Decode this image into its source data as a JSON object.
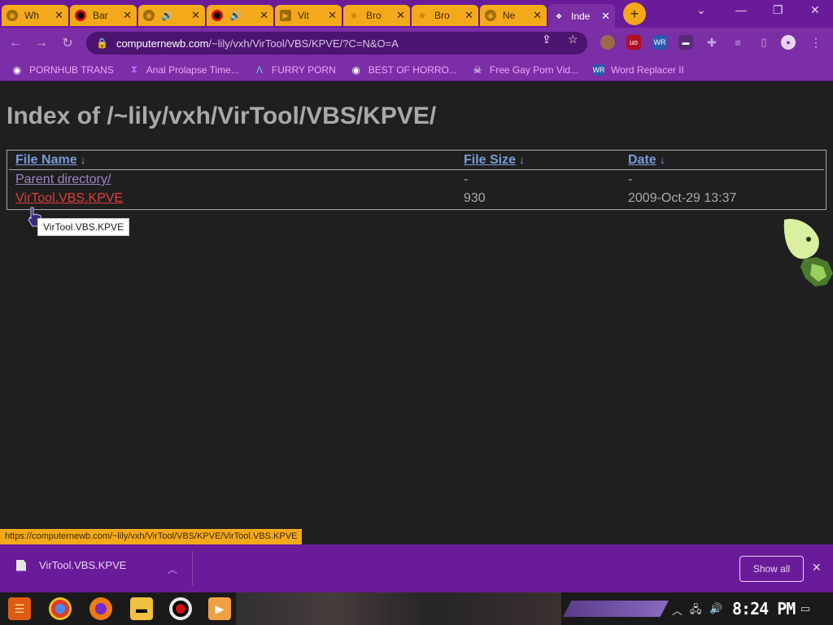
{
  "tabs": [
    {
      "title": "Wh",
      "icon": "chrome-globe-icon",
      "fav_color": "#9e6b00"
    },
    {
      "title": "Bar",
      "icon": "record-icon",
      "fav_color": "#b00000"
    },
    {
      "title": "🔊",
      "icon": "chrome-globe-icon",
      "fav_color": "#9e6b00"
    },
    {
      "title": "🔊",
      "icon": "record-icon",
      "fav_color": "#b00000"
    },
    {
      "title": "Vit",
      "icon": "video-icon",
      "fav_color": "#9e6b00"
    },
    {
      "title": "Bro",
      "icon": "ufo-icon",
      "fav_color": "#9e6b00"
    },
    {
      "title": "Bro",
      "icon": "ufo-icon",
      "fav_color": "#9e6b00"
    },
    {
      "title": "Ne",
      "icon": "chrome-globe-icon",
      "fav_color": "#9e6b00"
    },
    {
      "title": "Inde",
      "icon": "page-icon",
      "fav_color": "#ffffff"
    }
  ],
  "new_tab": "+",
  "address": {
    "domain": "computernewb.com",
    "path": "/~lily/vxh/VirTool/VBS/KPVE/?C=N&O=A"
  },
  "bookmarks": [
    {
      "label": "PORNHUB TRANS",
      "icon": "globe-icon"
    },
    {
      "label": "Anal Prolapse Time...",
      "icon": "hourglass-icon"
    },
    {
      "label": "FURRY PORN",
      "icon": "lambda-icon"
    },
    {
      "label": "BEST OF HORRO...",
      "icon": "globe-icon"
    },
    {
      "label": "Free Gay Porn Vid...",
      "icon": "skull-icon"
    },
    {
      "label": "Word Replacer II",
      "icon": "wr-icon"
    }
  ],
  "page": {
    "title": "Index of /~lily/vxh/VirTool/VBS/KPVE/",
    "columns": [
      "File Name",
      "File Size",
      "Date"
    ],
    "sort_arrow": "↓",
    "rows": [
      {
        "name": "Parent directory/",
        "size": "-",
        "date": "-"
      },
      {
        "name": "VirTool.VBS.KPVE",
        "size": "930",
        "date": "2009-Oct-29 13:37"
      }
    ],
    "tooltip": "VirTool.VBS.KPVE"
  },
  "status_url": "https://computernewb.com/~lily/vxh/VirTool/VBS/KPVE/VirTool.VBS.KPVE",
  "download": {
    "filename": "VirTool.VBS.KPVE",
    "show_all": "Show all"
  },
  "taskbar": {
    "clock": "8:24 PM"
  },
  "colors": {
    "tab_inactive": "#f4a91a",
    "chrome_purple": "#7b2ea5",
    "link_hover": "#e23c3c"
  }
}
